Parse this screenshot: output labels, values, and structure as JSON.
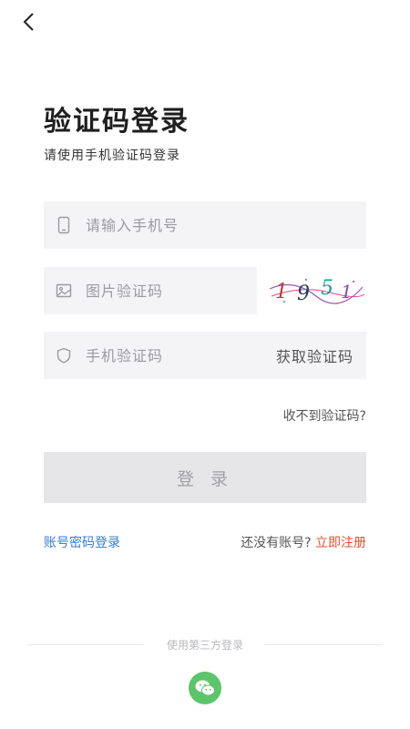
{
  "header": {
    "back_icon": "chevron-left-icon"
  },
  "title": "验证码登录",
  "subtitle": "请使用手机验证码登录",
  "form": {
    "phone": {
      "placeholder": "请输入手机号",
      "icon": "phone-icon"
    },
    "captcha": {
      "placeholder": "图片验证码",
      "icon": "image-icon",
      "captcha_text": "1 9 5 1"
    },
    "sms": {
      "placeholder": "手机验证码",
      "icon": "shield-icon",
      "get_code_label": "获取验证码"
    },
    "no_code_label": "收不到验证码?",
    "login_label": "登 录"
  },
  "links": {
    "password_login": "账号密码登录",
    "no_account": "还没有账号?",
    "register": "立即注册"
  },
  "third_party": {
    "label": "使用第三方登录",
    "wechat_icon": "wechat-icon"
  },
  "colors": {
    "accent_blue": "#3a7bd5",
    "register_orange": "#e0522b",
    "wechat_green": "#5cc46a",
    "field_bg": "#f4f4f6"
  }
}
